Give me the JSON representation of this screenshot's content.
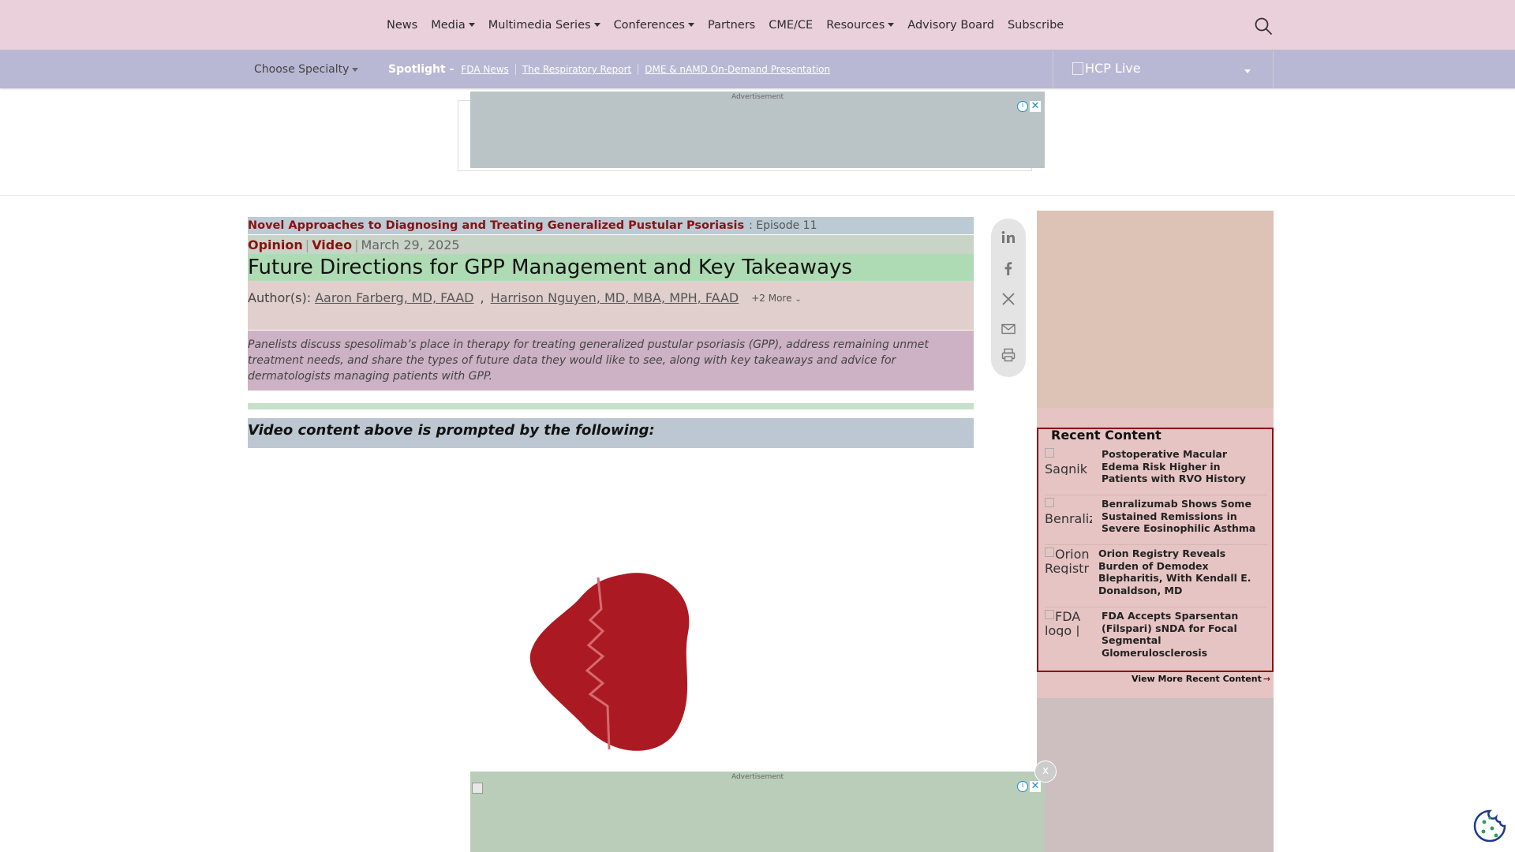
{
  "topnav": {
    "items": [
      {
        "label": "News",
        "dropdown": false
      },
      {
        "label": "Media",
        "dropdown": true
      },
      {
        "label": "Multimedia Series",
        "dropdown": true
      },
      {
        "label": "Conferences",
        "dropdown": true
      },
      {
        "label": "Partners",
        "dropdown": false
      },
      {
        "label": "CME/CE",
        "dropdown": false
      },
      {
        "label": "Resources",
        "dropdown": true
      },
      {
        "label": "Advisory Board",
        "dropdown": false
      },
      {
        "label": "Subscribe",
        "dropdown": false
      }
    ],
    "search_icon": "search-icon"
  },
  "subnav": {
    "choose_specialty": "Choose Specialty",
    "spotlight_label": "Spotlight -",
    "spotlight_links": [
      "FDA News",
      "The Respiratory Report",
      "DME & nAMD On-Demand Presentation"
    ],
    "brand": "HCP Live"
  },
  "ads": {
    "label": "Advertisement",
    "dismiss": "x"
  },
  "article": {
    "series_title": "Novel Approaches to Diagnosing and Treating Generalized Pustular Psoriasis",
    "episode": ": Episode 11",
    "tag_opinion": "Opinion",
    "tag_video": "Video",
    "date": "March 29, 2025",
    "title": "Future Directions for GPP Management and Key Takeaways",
    "authors_label": "Author(s):",
    "authors": [
      "Aaron Farberg, MD, FAAD",
      "Harrison Nguyen, MD, MBA, MPH, FAAD"
    ],
    "more_authors": "+2 More",
    "summary": "Panelists discuss spesolimab’s place in therapy for treating generalized pustular psoriasis (GPP), address remaining unmet treatment needs, and share the types of future data they would like to see, along with key takeaways and advice for dermatologists managing patients with GPP.",
    "prompt_heading": "Video content above is prompted by the following:"
  },
  "share": {
    "icons": [
      "linkedin-icon",
      "facebook-icon",
      "x-icon",
      "email-icon",
      "print-icon"
    ]
  },
  "recent": {
    "title": "Recent Content",
    "items": [
      {
        "thumb_alt": "Sagnik",
        "title": "Postoperative Macular Edema Risk Higher in Patients with RVO History"
      },
      {
        "thumb_alt": "Benraliz",
        "title": "Benralizumab Shows Some Sustained Remissions in Severe Eosinophilic Asthma"
      },
      {
        "thumb_alt": "Orion Registr",
        "title": "Orion Registry Reveals Burden of Demodex Blepharitis, With Kendall E. Donaldson, MD"
      },
      {
        "thumb_alt": "FDA logo |",
        "title": "FDA Accepts Sparsentan (Filspari) sNDA for Focal Segmental Glomerulosclerosis"
      }
    ],
    "view_more": "View More Recent Content",
    "view_more_arrow": "→"
  },
  "colors": {
    "accent": "#8b1010",
    "topnav_bg": "#ead0da",
    "subnav_bg": "#b8b8d4",
    "heart": "#ab1a22"
  }
}
